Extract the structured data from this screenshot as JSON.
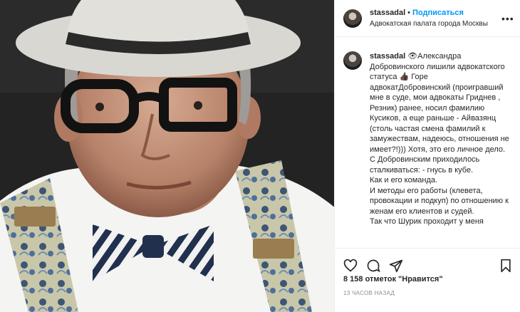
{
  "header": {
    "username": "stassadal",
    "separator": "•",
    "follow_label": "Подписаться",
    "location": "Адвокатская палата города Москвы",
    "more_icon": "more-options-icon"
  },
  "caption": {
    "username": "stassadal",
    "text": "👁Александра Добровинского лишили адвокатского статуса 👍🏿 Горе адвокатДобровинский (проигравший мне в суде, мои адвокаты Гриднев , Резник) ранее, носил фамилию Кусиков, а еще раньше - Айвазянц (столь частая смена фамилий к замужествам, надеюсь, отношения не имеет?!))) Хотя, это его личное дело.\nС Добровинским приходилось сталкиваться: - гнусь в кубе.\nКак и его команда.\nИ методы его работы (клевета, провокации и подкуп) по отношению к женам его клиентов и судей.\nТак что Шурик проходит у меня"
  },
  "actions": {
    "icons": [
      "heart-icon",
      "comment-icon",
      "share-icon",
      "bookmark-icon"
    ]
  },
  "likes": "8 158 отметок \"Нравится\"",
  "time_ago": "13 часов назад",
  "colors": {
    "accent": "#0095f6",
    "text": "#262626",
    "muted": "#8e8e8e",
    "border": "#efefef"
  }
}
